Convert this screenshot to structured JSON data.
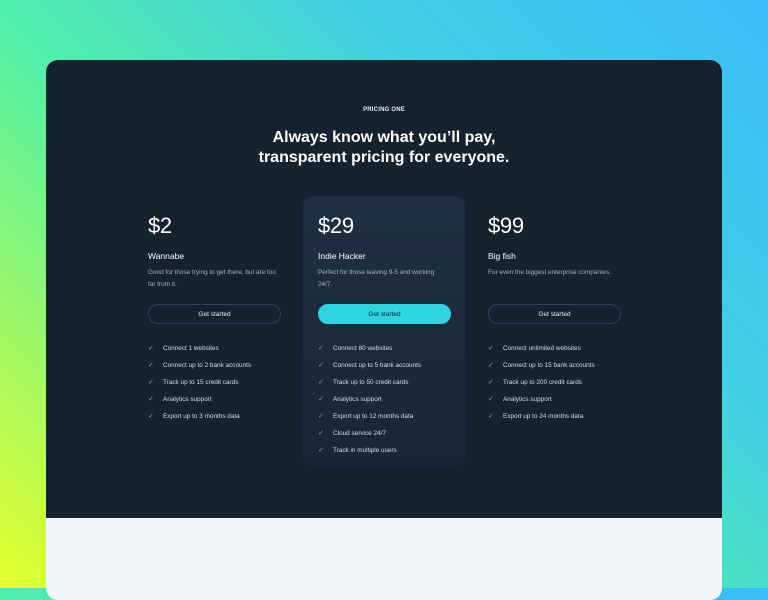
{
  "section": {
    "eyebrow": "PRICING ONE",
    "headline_line1": "Always know what you’ll pay,",
    "headline_line2": "transparent pricing for everyone."
  },
  "plans": [
    {
      "price": "$2",
      "name": "Wannabe",
      "description": "Good for those trying to get there, but are too far from it.",
      "cta": "Get started",
      "features": [
        "Connect 1 websites",
        "Connect up to 2 bank accounts",
        "Track up to 15 credit cards",
        "Analytics support",
        "Export up to 3 months data"
      ]
    },
    {
      "price": "$29",
      "name": "Indie Hacker",
      "description": "Perfect for those leaving 9-5 and working 24/7.",
      "cta": "Get started",
      "features": [
        "Connect 80 websites",
        "Connect up to 5 bank accounts",
        "Track up to 50 credit cards",
        "Analytics support",
        "Export up to 12 months data",
        "Cloud service 24/7",
        "Track in multiple users"
      ]
    },
    {
      "price": "$99",
      "name": "Big fish",
      "description": "For even the biggest enterprise companies.",
      "cta": "Get started",
      "features": [
        "Connect unlimited websites",
        "Connect up to 15 bank accounts",
        "Track up to 200 credit cards",
        "Analytics support",
        "Export up to 24 months data"
      ]
    }
  ],
  "icons": {
    "feature": "check-icon"
  },
  "colors": {
    "accent": "#2ed4e0",
    "panel": "#15222f",
    "featured_card": "#1f3042"
  }
}
